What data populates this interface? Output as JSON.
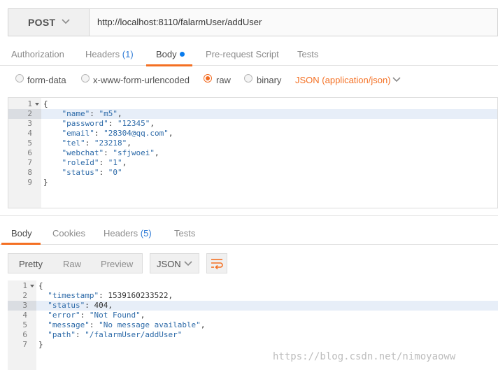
{
  "request": {
    "method": "POST",
    "url": "http://localhost:8110/falarmUser/addUser",
    "tabs": {
      "authorization": "Authorization",
      "headers": "Headers",
      "headers_count": "(1)",
      "body": "Body",
      "prerequest": "Pre-request Script",
      "tests": "Tests"
    },
    "body_modes": {
      "form_data": "form-data",
      "urlencoded": "x-www-form-urlencoded",
      "raw": "raw",
      "binary": "binary",
      "selected": "raw"
    },
    "content_type": "JSON (application/json)",
    "body_lines": [
      {
        "num": "1",
        "text": "{"
      },
      {
        "num": "2",
        "text": "    \"name\": \"m5\","
      },
      {
        "num": "3",
        "text": "    \"password\": \"12345\","
      },
      {
        "num": "4",
        "text": "    \"email\": \"28304@qq.com\","
      },
      {
        "num": "5",
        "text": "    \"tel\": \"23218\","
      },
      {
        "num": "6",
        "text": "    \"webchat\": \"sfjwoei\","
      },
      {
        "num": "7",
        "text": "    \"roleId\": \"1\","
      },
      {
        "num": "8",
        "text": "    \"status\": \"0\""
      },
      {
        "num": "9",
        "text": "}"
      }
    ]
  },
  "response": {
    "tabs": {
      "body": "Body",
      "cookies": "Cookies",
      "headers": "Headers",
      "headers_count": "(5)",
      "tests": "Tests"
    },
    "view_modes": {
      "pretty": "Pretty",
      "raw": "Raw",
      "preview": "Preview"
    },
    "format": "JSON",
    "body_lines": [
      {
        "num": "1",
        "text": "{"
      },
      {
        "num": "2",
        "text": "  \"timestamp\": 1539160233522,"
      },
      {
        "num": "3",
        "text": "  \"status\": 404,"
      },
      {
        "num": "4",
        "text": "  \"error\": \"Not Found\","
      },
      {
        "num": "5",
        "text": "  \"message\": \"No message available\","
      },
      {
        "num": "6",
        "text": "  \"path\": \"/falarmUser/addUser\""
      },
      {
        "num": "7",
        "text": "}"
      }
    ]
  },
  "watermark": "https://blog.csdn.net/nimoyaoww",
  "colors": {
    "accent": "#f47023",
    "count_blue": "#2f7bd6",
    "json_key": "#2d6aa8",
    "active_line": "#e7eef8"
  },
  "icons": {
    "method_dropdown": "chevron-down-icon",
    "content_type_dropdown": "chevron-down-icon",
    "format_dropdown": "chevron-down-icon",
    "wrap": "wrap-lines-icon",
    "fold": "fold-arrow-icon"
  }
}
